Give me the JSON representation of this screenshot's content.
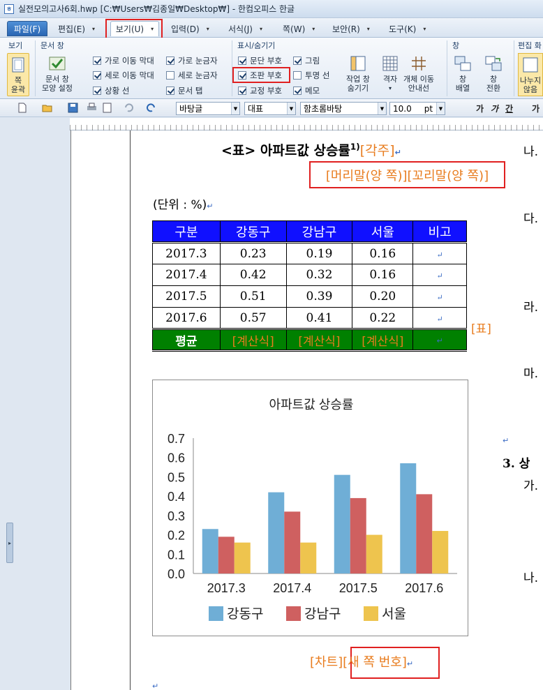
{
  "window": {
    "title": "실전모의고사6회.hwp [C:₩Users₩김종일₩Desktop₩] - 한컴오피스 한글"
  },
  "menu": [
    {
      "label": "파일(F)",
      "caret": ""
    },
    {
      "label": "편집(E)",
      "caret": "▾"
    },
    {
      "label": "보기(U)",
      "caret": "▾"
    },
    {
      "label": "입력(D)",
      "caret": "▾"
    },
    {
      "label": "서식(J)",
      "caret": "▾"
    },
    {
      "label": "쪽(W)",
      "caret": "▾"
    },
    {
      "label": "보안(R)",
      "caret": "▾"
    },
    {
      "label": "도구(K)",
      "caret": "▾"
    }
  ],
  "ribbon": {
    "groups": {
      "view": "보기",
      "docwin": "문서 창",
      "showhide": "표시/숨기기",
      "window": "창",
      "edit": "편집 화"
    },
    "page_outline": "쪽\n윤곽",
    "docwin_shape": "문서 창\n모양 설정",
    "checks": {
      "h_scroll": "가로 이동 막대",
      "v_scroll": "세로 이동 막대",
      "status_line": "상황 선",
      "h_ruler": "가로 눈금자",
      "v_ruler": "세로 눈금자",
      "doc_tab": "문서 탭",
      "para_mark": "문단 부호",
      "layout_mark": "조판 부호",
      "revision_mark": "교정 부호",
      "picture": "그림",
      "transparent_line": "투명 선",
      "memo": "메모"
    },
    "work_window": "작업 창\n숨기기",
    "grid": "격자",
    "object_guide": "개체 이동\n안내선",
    "window_arrange": "창\n배열",
    "window_switch": "창\n전환",
    "split": "나누지\n않음"
  },
  "toolbar": {
    "style": "바탕글",
    "lang": "대표",
    "font": "함초롬바탕",
    "size": "10.0",
    "unit": "pt",
    "fmt_letters": [
      "가",
      "가",
      "간",
      "가"
    ]
  },
  "doc": {
    "title": "<표> 아파트값 상승률",
    "title_sup": "1)",
    "title_tag": "[각주]",
    "header_footer": "[머리말(양 쪽)][꼬리말(양 쪽)]",
    "unit": "(단위 : %)",
    "table": {
      "headers": [
        "구분",
        "강동구",
        "강남구",
        "서울",
        "비고"
      ],
      "rows": [
        [
          "2017.3",
          "0.23",
          "0.19",
          "0.16",
          ""
        ],
        [
          "2017.4",
          "0.42",
          "0.32",
          "0.16",
          ""
        ],
        [
          "2017.5",
          "0.51",
          "0.39",
          "0.20",
          ""
        ],
        [
          "2017.6",
          "0.57",
          "0.41",
          "0.22",
          ""
        ]
      ],
      "avg_label": "평균",
      "avg_cells": [
        "[계산식]",
        "[계산식]",
        "[계산식]"
      ]
    },
    "table_tag": "[표]",
    "chart_tag": "[차트][새 쪽 번호]",
    "right_items": [
      "나.",
      "다.",
      "라.",
      "마.",
      "3. 상",
      "가.",
      "나."
    ]
  },
  "chart_data": {
    "type": "bar",
    "title": "아파트값 상승률",
    "categories": [
      "2017.3",
      "2017.4",
      "2017.5",
      "2017.6"
    ],
    "series": [
      {
        "name": "강동구",
        "values": [
          0.23,
          0.42,
          0.51,
          0.57
        ],
        "color": "#6faed6"
      },
      {
        "name": "강남구",
        "values": [
          0.19,
          0.32,
          0.39,
          0.41
        ],
        "color": "#cf6060"
      },
      {
        "name": "서울",
        "values": [
          0.16,
          0.16,
          0.2,
          0.22
        ],
        "color": "#eec44e"
      }
    ],
    "ylim": [
      0,
      0.7
    ],
    "yticks": [
      "0.0",
      "0.1",
      "0.2",
      "0.3",
      "0.4",
      "0.5",
      "0.6",
      "0.7"
    ],
    "grid": false,
    "legend": "bottom"
  }
}
